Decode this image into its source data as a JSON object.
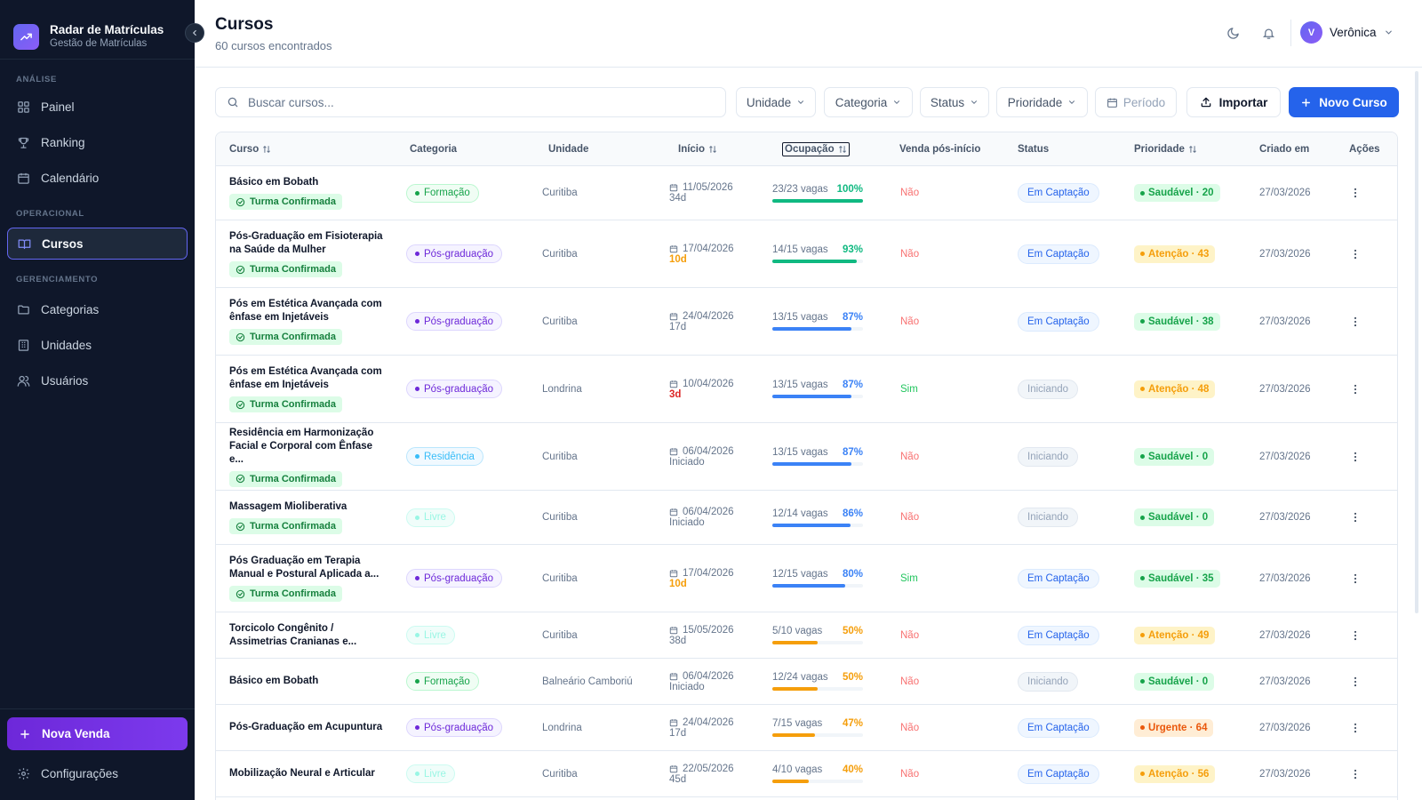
{
  "brand": {
    "title": "Radar de Matrículas",
    "subtitle": "Gestão de Matrículas",
    "icon": "trending-up-icon"
  },
  "sidebar": {
    "sections": [
      {
        "title": "ANÁLISE"
      },
      {
        "title": "OPERACIONAL"
      },
      {
        "title": "GERENCIAMENTO"
      }
    ],
    "items": [
      {
        "label": "Painel",
        "icon": "grid-icon"
      },
      {
        "label": "Ranking",
        "icon": "trophy-icon"
      },
      {
        "label": "Calendário",
        "icon": "calendar-icon"
      },
      {
        "label": "Cursos",
        "icon": "book-icon",
        "active": true
      },
      {
        "label": "Categorias",
        "icon": "folder-icon"
      },
      {
        "label": "Unidades",
        "icon": "building-icon"
      },
      {
        "label": "Usuários",
        "icon": "users-icon"
      }
    ],
    "primary_action": "Nova Venda",
    "settings": "Configurações"
  },
  "header": {
    "title": "Cursos",
    "subtitle": "60 cursos encontrados",
    "user": {
      "initial": "V",
      "name": "Verônica"
    }
  },
  "toolbar": {
    "search_placeholder": "Buscar cursos...",
    "filters": [
      "Unidade",
      "Categoria",
      "Status",
      "Prioridade"
    ],
    "period": "Período",
    "import": "Importar",
    "new_course": "Novo Curso"
  },
  "table": {
    "columns": [
      "Curso",
      "Categoria",
      "Unidade",
      "Início",
      "Ocupação",
      "Venda pós-início",
      "Status",
      "Prioridade",
      "Criado em",
      "Ações"
    ],
    "turma_label": "Turma Confirmada",
    "rows": [
      {
        "name": "Básico em Bobath",
        "turma": true,
        "category": "Formação",
        "unit": "Curitiba",
        "start": "11/05/2026",
        "rel": "34d",
        "rel_type": "normal",
        "vagas": "23/23 vagas",
        "pct": "100%",
        "fill": 1.0,
        "venda": "Não",
        "status": "Em Captação",
        "priority": "Saudável · 20",
        "created": "27/03/2026"
      },
      {
        "name": "Pós-Graduação em Fisioterapia na Saúde da Mulher",
        "turma": true,
        "category": "Pós-graduação",
        "unit": "Curitiba",
        "start": "17/04/2026",
        "rel": "10d",
        "rel_type": "warn",
        "vagas": "14/15 vagas",
        "pct": "93%",
        "fill": 0.93,
        "venda": "Não",
        "status": "Em Captação",
        "priority": "Atenção · 43",
        "created": "27/03/2026"
      },
      {
        "name": "Pós em Estética Avançada com ênfase em Injetáveis",
        "turma": true,
        "category": "Pós-graduação",
        "unit": "Curitiba",
        "start": "24/04/2026",
        "rel": "17d",
        "rel_type": "normal",
        "vagas": "13/15 vagas",
        "pct": "87%",
        "fill": 0.87,
        "venda": "Não",
        "status": "Em Captação",
        "priority": "Saudável · 38",
        "created": "27/03/2026"
      },
      {
        "name": "Pós em Estética Avançada com ênfase em Injetáveis",
        "turma": true,
        "category": "Pós-graduação",
        "unit": "Londrina",
        "start": "10/04/2026",
        "rel": "3d",
        "rel_type": "danger",
        "vagas": "13/15 vagas",
        "pct": "87%",
        "fill": 0.87,
        "venda": "Sim",
        "status": "Iniciando",
        "priority": "Atenção · 48",
        "created": "27/03/2026"
      },
      {
        "name": "Residência em Harmonização Facial e Corporal com Ênfase e...",
        "turma": true,
        "category": "Residência",
        "unit": "Curitiba",
        "start": "06/04/2026",
        "rel": "Iniciado",
        "rel_type": "normal",
        "vagas": "13/15 vagas",
        "pct": "87%",
        "fill": 0.87,
        "venda": "Não",
        "status": "Iniciando",
        "priority": "Saudável · 0",
        "created": "27/03/2026"
      },
      {
        "name": "Massagem Mioliberativa",
        "turma": true,
        "category": "Livre",
        "unit": "Curitiba",
        "start": "06/04/2026",
        "rel": "Iniciado",
        "rel_type": "normal",
        "vagas": "12/14 vagas",
        "pct": "86%",
        "fill": 0.86,
        "venda": "Não",
        "status": "Iniciando",
        "priority": "Saudável · 0",
        "created": "27/03/2026"
      },
      {
        "name": "Pós Graduação em Terapia Manual e Postural Aplicada a...",
        "turma": true,
        "category": "Pós-graduação",
        "unit": "Curitiba",
        "start": "17/04/2026",
        "rel": "10d",
        "rel_type": "warn",
        "vagas": "12/15 vagas",
        "pct": "80%",
        "fill": 0.8,
        "venda": "Sim",
        "status": "Em Captação",
        "priority": "Saudável · 35",
        "created": "27/03/2026"
      },
      {
        "name": "Torcicolo Congênito / Assimetrias Cranianas e...",
        "turma": false,
        "category": "Livre",
        "unit": "Curitiba",
        "start": "15/05/2026",
        "rel": "38d",
        "rel_type": "normal",
        "vagas": "5/10 vagas",
        "pct": "50%",
        "fill": 0.5,
        "venda": "Não",
        "status": "Em Captação",
        "priority": "Atenção · 49",
        "created": "27/03/2026"
      },
      {
        "name": "Básico em Bobath",
        "turma": false,
        "category": "Formação",
        "unit": "Balneário Camboriú",
        "start": "06/04/2026",
        "rel": "Iniciado",
        "rel_type": "normal",
        "vagas": "12/24 vagas",
        "pct": "50%",
        "fill": 0.5,
        "venda": "Não",
        "status": "Iniciando",
        "priority": "Saudável · 0",
        "created": "27/03/2026"
      },
      {
        "name": "Pós-Graduação em Acupuntura",
        "turma": false,
        "category": "Pós-graduação",
        "unit": "Londrina",
        "start": "24/04/2026",
        "rel": "17d",
        "rel_type": "normal",
        "vagas": "7/15 vagas",
        "pct": "47%",
        "fill": 0.47,
        "venda": "Não",
        "status": "Em Captação",
        "priority": "Urgente · 64",
        "created": "27/03/2026"
      },
      {
        "name": "Mobilização Neural e Articular",
        "turma": false,
        "category": "Livre",
        "unit": "Curitiba",
        "start": "22/05/2026",
        "rel": "45d",
        "rel_type": "normal",
        "vagas": "4/10 vagas",
        "pct": "40%",
        "fill": 0.4,
        "venda": "Não",
        "status": "Em Captação",
        "priority": "Atenção · 56",
        "created": "27/03/2026"
      }
    ]
  },
  "colors": {
    "sidebar_bg": "#0f172a",
    "accent_blue": "#2563eb",
    "accent_purple": "#7c3aed",
    "green": "#16a34a",
    "amber": "#f59e0b",
    "red": "#f87171"
  }
}
